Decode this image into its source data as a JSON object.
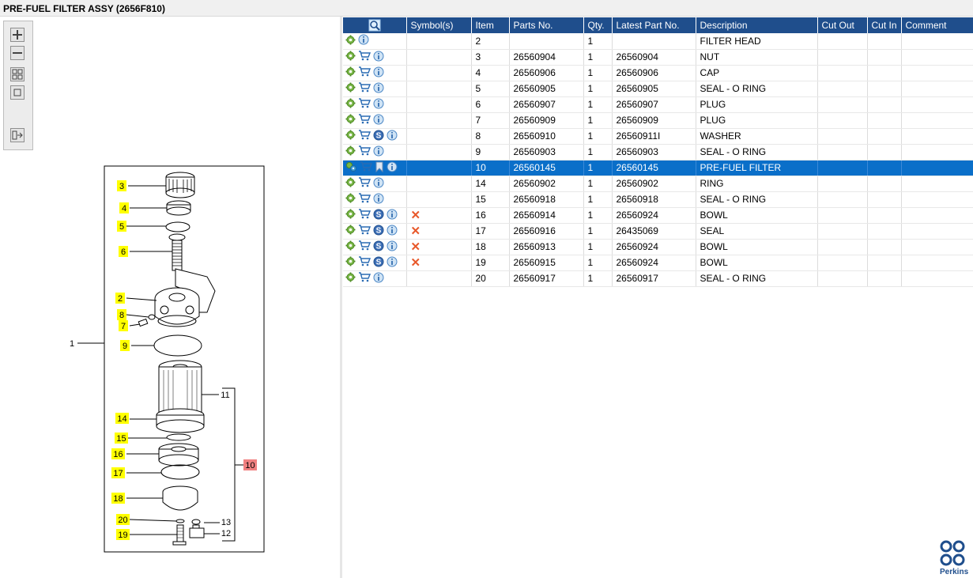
{
  "window": {
    "title": "PRE-FUEL FILTER ASSY (2656F810)"
  },
  "toolbar": {
    "buttons": [
      "zoom-in",
      "zoom-out",
      "fit-all",
      "fit-page",
      "toggle-layout"
    ]
  },
  "table": {
    "columns": [
      "",
      "Symbol(s)",
      "Item",
      "Parts No.",
      "Qty.",
      "Latest Part No.",
      "Description",
      "Cut Out",
      "Cut In",
      "Comment"
    ],
    "rows": [
      {
        "icons": [
          "gear",
          "info"
        ],
        "symbols": "",
        "item": "2",
        "part": "",
        "qty": "1",
        "latest": "",
        "desc": "FILTER HEAD",
        "cutout": "",
        "cutin": "",
        "comment": "",
        "selected": false
      },
      {
        "icons": [
          "gear",
          "cart",
          "info"
        ],
        "symbols": "",
        "item": "3",
        "part": "26560904",
        "qty": "1",
        "latest": "26560904",
        "desc": "NUT",
        "cutout": "",
        "cutin": "",
        "comment": "",
        "selected": false
      },
      {
        "icons": [
          "gear",
          "cart",
          "info"
        ],
        "symbols": "",
        "item": "4",
        "part": "26560906",
        "qty": "1",
        "latest": "26560906",
        "desc": "CAP",
        "cutout": "",
        "cutin": "",
        "comment": "",
        "selected": false
      },
      {
        "icons": [
          "gear",
          "cart",
          "info"
        ],
        "symbols": "",
        "item": "5",
        "part": "26560905",
        "qty": "1",
        "latest": "26560905",
        "desc": "SEAL - O RING",
        "cutout": "",
        "cutin": "",
        "comment": "",
        "selected": false
      },
      {
        "icons": [
          "gear",
          "cart",
          "info"
        ],
        "symbols": "",
        "item": "6",
        "part": "26560907",
        "qty": "1",
        "latest": "26560907",
        "desc": "PLUG",
        "cutout": "",
        "cutin": "",
        "comment": "",
        "selected": false
      },
      {
        "icons": [
          "gear",
          "cart",
          "info"
        ],
        "symbols": "",
        "item": "7",
        "part": "26560909",
        "qty": "1",
        "latest": "26560909",
        "desc": "PLUG",
        "cutout": "",
        "cutin": "",
        "comment": "",
        "selected": false
      },
      {
        "icons": [
          "gear",
          "cart",
          "s",
          "info"
        ],
        "symbols": "",
        "item": "8",
        "part": "26560910",
        "qty": "1",
        "latest": "26560911I",
        "desc": "WASHER",
        "cutout": "",
        "cutin": "",
        "comment": "",
        "selected": false
      },
      {
        "icons": [
          "gear",
          "cart",
          "info"
        ],
        "symbols": "",
        "item": "9",
        "part": "26560903",
        "qty": "1",
        "latest": "26560903",
        "desc": "SEAL - O RING",
        "cutout": "",
        "cutin": "",
        "comment": "",
        "selected": false
      },
      {
        "icons": [
          "gear-group",
          "cart",
          "bookmark",
          "info"
        ],
        "symbols": "",
        "item": "10",
        "part": "26560145",
        "qty": "1",
        "latest": "26560145",
        "desc": "PRE-FUEL FILTER",
        "cutout": "",
        "cutin": "",
        "comment": "",
        "selected": true
      },
      {
        "icons": [
          "gear",
          "cart",
          "info"
        ],
        "symbols": "",
        "item": "14",
        "part": "26560902",
        "qty": "1",
        "latest": "26560902",
        "desc": "RING",
        "cutout": "",
        "cutin": "",
        "comment": "",
        "selected": false
      },
      {
        "icons": [
          "gear",
          "cart",
          "info"
        ],
        "symbols": "",
        "item": "15",
        "part": "26560918",
        "qty": "1",
        "latest": "26560918",
        "desc": "SEAL - O RING",
        "cutout": "",
        "cutin": "",
        "comment": "",
        "selected": false
      },
      {
        "icons": [
          "gear",
          "cart",
          "s",
          "info"
        ],
        "symbols": "x",
        "item": "16",
        "part": "26560914",
        "qty": "1",
        "latest": "26560924",
        "desc": "BOWL",
        "cutout": "",
        "cutin": "",
        "comment": "",
        "selected": false
      },
      {
        "icons": [
          "gear",
          "cart",
          "s",
          "info"
        ],
        "symbols": "x",
        "item": "17",
        "part": "26560916",
        "qty": "1",
        "latest": "26435069",
        "desc": "SEAL",
        "cutout": "",
        "cutin": "",
        "comment": "",
        "selected": false
      },
      {
        "icons": [
          "gear",
          "cart",
          "s",
          "info"
        ],
        "symbols": "x",
        "item": "18",
        "part": "26560913",
        "qty": "1",
        "latest": "26560924",
        "desc": "BOWL",
        "cutout": "",
        "cutin": "",
        "comment": "",
        "selected": false
      },
      {
        "icons": [
          "gear",
          "cart",
          "s",
          "info"
        ],
        "symbols": "x",
        "item": "19",
        "part": "26560915",
        "qty": "1",
        "latest": "26560924",
        "desc": "BOWL",
        "cutout": "",
        "cutin": "",
        "comment": "",
        "selected": false
      },
      {
        "icons": [
          "gear",
          "cart",
          "info"
        ],
        "symbols": "",
        "item": "20",
        "part": "26560917",
        "qty": "1",
        "latest": "26560917",
        "desc": "SEAL - O RING",
        "cutout": "",
        "cutin": "",
        "comment": "",
        "selected": false
      }
    ]
  },
  "diagram": {
    "callouts": [
      {
        "label": "3",
        "style": "yellow"
      },
      {
        "label": "4",
        "style": "yellow"
      },
      {
        "label": "5",
        "style": "yellow"
      },
      {
        "label": "6",
        "style": "yellow"
      },
      {
        "label": "2",
        "style": "yellow"
      },
      {
        "label": "8",
        "style": "yellow"
      },
      {
        "label": "7",
        "style": "yellow"
      },
      {
        "label": "9",
        "style": "yellow"
      },
      {
        "label": "14",
        "style": "yellow"
      },
      {
        "label": "15",
        "style": "yellow"
      },
      {
        "label": "16",
        "style": "yellow"
      },
      {
        "label": "17",
        "style": "yellow"
      },
      {
        "label": "18",
        "style": "yellow"
      },
      {
        "label": "20",
        "style": "yellow"
      },
      {
        "label": "19",
        "style": "yellow"
      },
      {
        "label": "10",
        "style": "red"
      },
      {
        "label": "1",
        "style": "plain"
      },
      {
        "label": "11",
        "style": "plain"
      },
      {
        "label": "13",
        "style": "plain"
      },
      {
        "label": "12",
        "style": "plain"
      }
    ]
  },
  "brand": {
    "name": "Perkins",
    "color": "#1f4e8c"
  },
  "colors": {
    "header": "#1f4e8c",
    "selected": "#0a6fc9",
    "callout": "#ffff00",
    "callout_selected": "#f08080"
  }
}
